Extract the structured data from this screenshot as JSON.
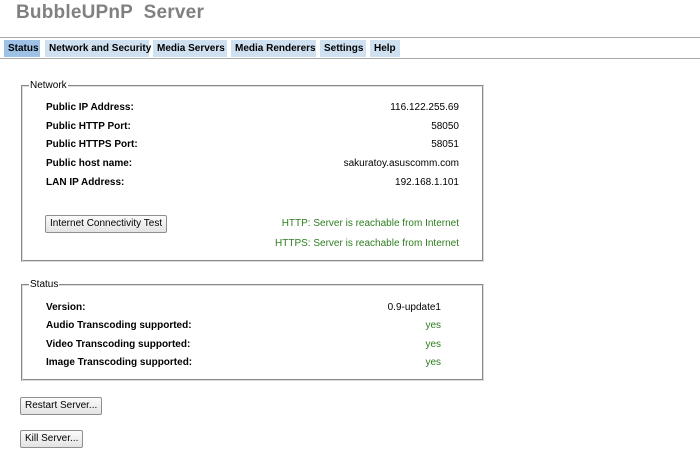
{
  "app": {
    "title": "BubbleUPnP  Server"
  },
  "tabs": [
    {
      "label": "Status",
      "active": true
    },
    {
      "label": "Network and Security",
      "active": false
    },
    {
      "label": "Media Servers",
      "active": false
    },
    {
      "label": "Media Renderers",
      "active": false
    },
    {
      "label": "Settings",
      "active": false
    },
    {
      "label": "Help",
      "active": false
    }
  ],
  "network": {
    "legend": "Network",
    "rows": [
      {
        "label": "Public IP Address:",
        "value": "116.122.255.69"
      },
      {
        "label": "Public HTTP Port:",
        "value": "58050"
      },
      {
        "label": "Public HTTPS Port:",
        "value": "58051"
      },
      {
        "label": "Public host name:",
        "value": "sakuratoy.asuscomm.com"
      },
      {
        "label": "LAN IP Address:",
        "value": "192.168.1.101"
      }
    ],
    "test_button": "Internet Connectivity Test",
    "http_result": "HTTP: Server is reachable from Internet",
    "https_result": "HTTPS: Server is reachable from Internet"
  },
  "status": {
    "legend": "Status",
    "rows": [
      {
        "label": "Version:",
        "value": "0.9-update1"
      },
      {
        "label": "Audio Transcoding supported:",
        "value": "yes"
      },
      {
        "label": "Video Transcoding supported:",
        "value": "yes"
      },
      {
        "label": "Image Transcoding supported:",
        "value": "yes"
      }
    ]
  },
  "actions": {
    "restart_label": "Restart Server...",
    "kill_label": "Kill Server..."
  },
  "colors": {
    "title": "#808080",
    "tab_bg": "#cfe0f1",
    "tab_active_bg": "#9ec2e6",
    "success_text": "#2e7d1f"
  }
}
